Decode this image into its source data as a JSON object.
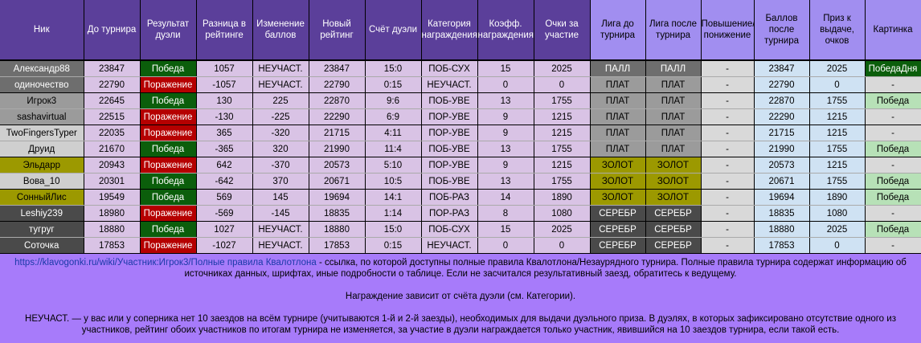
{
  "headers": [
    "Ник",
    "До турнира",
    "Результат дуэли",
    "Разница в рейтинге",
    "Изменение баллов",
    "Новый рейтинг",
    "Счёт дуэли",
    "Категория награждения",
    "Коэфф. награждения",
    "Очки за участие",
    "Лига до турнира",
    "Лига после турнира",
    "Повышение/ понижение",
    "Баллов после турнира",
    "Приз к выдаче, очков",
    "Картинка"
  ],
  "rows": [
    {
      "nick": "Александр88",
      "before": "23847",
      "result": "Победа",
      "diff": "1057",
      "change": "НЕУЧАСТ.",
      "new_rating": "23847",
      "score": "15:0",
      "category": "ПОБ-СУХ",
      "coef": "15",
      "points": "2025",
      "league_before": "ПАЛЛ",
      "league_after": "ПАЛЛ",
      "promo": "-",
      "after_points": "23847",
      "prize": "2025",
      "picture": "ПобедаДня"
    },
    {
      "nick": "одиночество",
      "before": "22790",
      "result": "Поражение",
      "diff": "-1057",
      "change": "НЕУЧАСТ.",
      "new_rating": "22790",
      "score": "0:15",
      "category": "НЕУЧАСТ.",
      "coef": "0",
      "points": "0",
      "league_before": "ПЛАТ",
      "league_after": "ПЛАТ",
      "promo": "-",
      "after_points": "22790",
      "prize": "0",
      "picture": "-"
    },
    {
      "nick": "Игрок3",
      "before": "22645",
      "result": "Победа",
      "diff": "130",
      "change": "225",
      "new_rating": "22870",
      "score": "9:6",
      "category": "ПОБ-УВЕ",
      "coef": "13",
      "points": "1755",
      "league_before": "ПЛАТ",
      "league_after": "ПЛАТ",
      "promo": "-",
      "after_points": "22870",
      "prize": "1755",
      "picture": "Победа"
    },
    {
      "nick": "sashavirtual",
      "before": "22515",
      "result": "Поражение",
      "diff": "-130",
      "change": "-225",
      "new_rating": "22290",
      "score": "6:9",
      "category": "ПОР-УВЕ",
      "coef": "9",
      "points": "1215",
      "league_before": "ПЛАТ",
      "league_after": "ПЛАТ",
      "promo": "-",
      "after_points": "22290",
      "prize": "1215",
      "picture": "-"
    },
    {
      "nick": "TwoFingersTyper",
      "before": "22035",
      "result": "Поражение",
      "diff": "365",
      "change": "-320",
      "new_rating": "21715",
      "score": "4:11",
      "category": "ПОР-УВЕ",
      "coef": "9",
      "points": "1215",
      "league_before": "ПЛАТ",
      "league_after": "ПЛАТ",
      "promo": "-",
      "after_points": "21715",
      "prize": "1215",
      "picture": "-"
    },
    {
      "nick": "Друид",
      "before": "21670",
      "result": "Победа",
      "diff": "-365",
      "change": "320",
      "new_rating": "21990",
      "score": "11:4",
      "category": "ПОБ-УВЕ",
      "coef": "13",
      "points": "1755",
      "league_before": "ПЛАТ",
      "league_after": "ПЛАТ",
      "promo": "-",
      "after_points": "21990",
      "prize": "1755",
      "picture": "Победа"
    },
    {
      "nick": "Эльдарр",
      "before": "20943",
      "result": "Поражение",
      "diff": "642",
      "change": "-370",
      "new_rating": "20573",
      "score": "5:10",
      "category": "ПОР-УВЕ",
      "coef": "9",
      "points": "1215",
      "league_before": "ЗОЛОТ",
      "league_after": "ЗОЛОТ",
      "promo": "-",
      "after_points": "20573",
      "prize": "1215",
      "picture": "-"
    },
    {
      "nick": "Вова_10",
      "before": "20301",
      "result": "Победа",
      "diff": "-642",
      "change": "370",
      "new_rating": "20671",
      "score": "10:5",
      "category": "ПОБ-УВЕ",
      "coef": "13",
      "points": "1755",
      "league_before": "ЗОЛОТ",
      "league_after": "ЗОЛОТ",
      "promo": "-",
      "after_points": "20671",
      "prize": "1755",
      "picture": "Победа"
    },
    {
      "nick": "СонныйЛис",
      "before": "19549",
      "result": "Победа",
      "diff": "569",
      "change": "145",
      "new_rating": "19694",
      "score": "14:1",
      "category": "ПОБ-РАЗ",
      "coef": "14",
      "points": "1890",
      "league_before": "ЗОЛОТ",
      "league_after": "ЗОЛОТ",
      "promo": "-",
      "after_points": "19694",
      "prize": "1890",
      "picture": "Победа"
    },
    {
      "nick": "Leshiy239",
      "before": "18980",
      "result": "Поражение",
      "diff": "-569",
      "change": "-145",
      "new_rating": "18835",
      "score": "1:14",
      "category": "ПОР-РАЗ",
      "coef": "8",
      "points": "1080",
      "league_before": "СЕРЕБР",
      "league_after": "СЕРЕБР",
      "promo": "-",
      "after_points": "18835",
      "prize": "1080",
      "picture": "-"
    },
    {
      "nick": "тугруг",
      "before": "18880",
      "result": "Победа",
      "diff": "1027",
      "change": "НЕУЧАСТ.",
      "new_rating": "18880",
      "score": "15:0",
      "category": "ПОБ-СУХ",
      "coef": "15",
      "points": "2025",
      "league_before": "СЕРЕБР",
      "league_after": "СЕРЕБР",
      "promo": "-",
      "after_points": "18880",
      "prize": "2025",
      "picture": "Победа"
    },
    {
      "nick": "Соточка",
      "before": "17853",
      "result": "Поражение",
      "diff": "-1027",
      "change": "НЕУЧАСТ.",
      "new_rating": "17853",
      "score": "0:15",
      "category": "НЕУЧАСТ.",
      "coef": "0",
      "points": "0",
      "league_before": "СЕРЕБР",
      "league_after": "СЕРЕБР",
      "promo": "-",
      "after_points": "17853",
      "prize": "0",
      "picture": "-"
    }
  ],
  "footer": {
    "link_text": "https://klavogonki.ru/wiki/Участник:Игрок3/Полные правила Квалотлона",
    "line1_rest": " - ссылка, по которой доступны полные правила Квалотлона/Незаурядного турнира. Полные правила турнира содержат информацию об источниках данных, шрифтах, иные подробности о таблице. Если не засчитался результативный заезд, обратитесь к ведущему.",
    "line2": "Награждение зависит от счёта дуэли (см. Категории).",
    "line3": "НЕУЧАСТ. — у вас или у соперника нет 10 заездов на всём турнире (учитываются 1-й и 2-й заезды), необходимых для выдачи дуэльного приза. В дуэлях, в которых зафиксировано отсутствие одного из участников, рейтинг обоих участников по итогам турнира не изменяется, за участие в дуэли награждается только участник, явившийся на 10 заездов турнира, если такой есть."
  },
  "colors": {
    "header_purple": "#5b3f9a",
    "header_blue": "#a18ef0",
    "win": "#0b5e0b",
    "loss": "#b50000",
    "gold": "#9c9900",
    "footer_bg": "#a77bfa"
  }
}
